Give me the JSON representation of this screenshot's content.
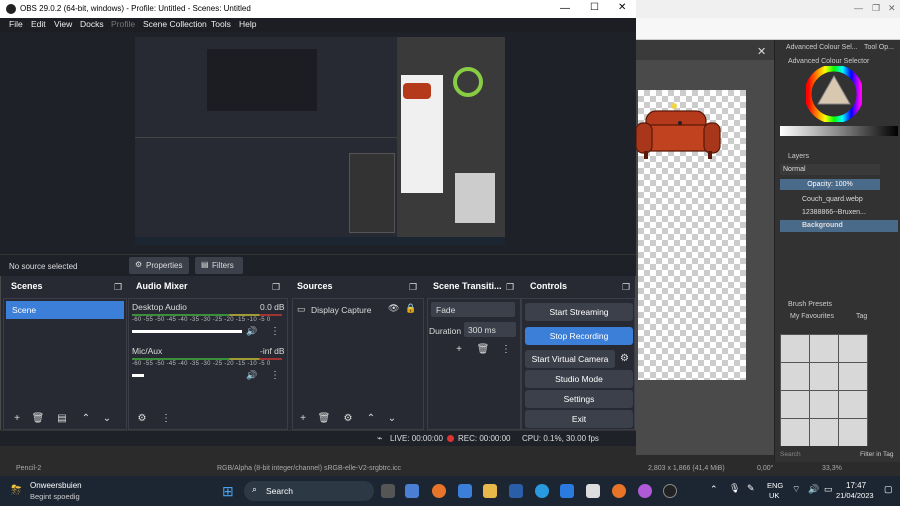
{
  "obs": {
    "title": "OBS 29.0.2 (64-bit, windows) - Profile: Untitled - Scenes: Untitled",
    "menu": [
      "File",
      "Edit",
      "View",
      "Docks",
      "Profile",
      "Scene Collection",
      "Tools",
      "Help"
    ],
    "source_status": "No source selected",
    "properties_label": "Properties",
    "filters_label": "Filters",
    "scenes": {
      "title": "Scenes",
      "items": [
        "Scene"
      ]
    },
    "audio": {
      "title": "Audio Mixer",
      "channels": [
        {
          "name": "Desktop Audio",
          "level": "0.0 dB"
        },
        {
          "name": "Mic/Aux",
          "level": "-inf dB"
        }
      ],
      "ticks": "-60 -55 -50 -45 -40 -35 -30 -25 -20 -15 -10 -5 0"
    },
    "sources": {
      "title": "Sources",
      "items": [
        "Display Capture"
      ]
    },
    "transitions": {
      "title": "Scene Transiti...",
      "type": "Fade",
      "duration_label": "Duration",
      "duration": "300 ms"
    },
    "controls": {
      "title": "Controls",
      "buttons": [
        "Start Streaming",
        "Stop Recording",
        "Start Virtual Camera",
        "Studio Mode",
        "Settings",
        "Exit"
      ]
    },
    "status": {
      "live": "LIVE: 00:00:00",
      "rec": "REC: 00:00:00",
      "cpu": "CPU: 0.1%, 30.00 fps"
    }
  },
  "krita": {
    "tabs": [
      "Advanced Colour Sel...",
      "Tool Op..."
    ],
    "color_selector_title": "Advanced Colour Selector",
    "layers_title": "Layers",
    "blend_mode": "Normal",
    "opacity": "Opacity: 100%",
    "layers": [
      "Couch_quard.webp",
      "12388866--Bruxen...",
      "Background"
    ],
    "brush_presets_title": "Brush Presets",
    "brush_filter": "My Favourites",
    "brush_tag": "Tag",
    "search_placeholder": "Search",
    "filter_in_tag": "Filter in Tag",
    "status_left": "Pencil-2",
    "status_color": "RGB/Alpha (8-bit integer/channel)  sRGB-elle-V2-srgbtrc.icc",
    "status_size": "2,803 x 1,866 (41,4 MiB)",
    "status_angle": "0,00°",
    "zoom": "33,3%"
  },
  "taskbar": {
    "weather_title": "Onweersbuien",
    "weather_sub": "Begint spoedig",
    "search": "Search",
    "lang_top": "ENG",
    "lang_bot": "UK",
    "time": "17:47",
    "date": "21/04/2023"
  },
  "colors": {
    "accent": "#3c7fd8",
    "obs_bg": "#272a33",
    "record_btn": "#3c7fd8",
    "rec_dot": "#d33"
  }
}
